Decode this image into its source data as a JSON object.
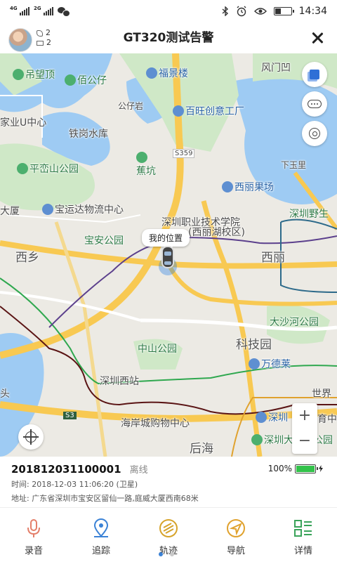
{
  "status_bar": {
    "sim1_tag": "4G",
    "sim2_tag": "2G",
    "time": "14:34",
    "icons": [
      "signal-icon",
      "wechat-icon",
      "bluetooth-icon",
      "alarm-icon",
      "eye-icon",
      "battery-icon"
    ]
  },
  "header": {
    "title": "GT320测试告警",
    "call_count": "2",
    "message_count": "2"
  },
  "map": {
    "my_location_label": "我的位置",
    "labels": {
      "l1": "吊望顶",
      "l2": "佰公仔",
      "l3": "福景楼",
      "l4": "风门凹",
      "l5": "公仔岩",
      "l6": "百旺创意工厂",
      "l7": "家业U中心",
      "l8": "铁岗水库",
      "l9": "蕉坑",
      "l10": "下玉里",
      "l11": "平峦山公园",
      "l12": "西丽果场",
      "l13": "大厦",
      "l14": "宝运达物流中心",
      "l15": "深圳职业技术学院",
      "l16": "(西丽湖校区)",
      "l17": "深圳野生",
      "l18": "宝安公园",
      "l19": "西乡",
      "l20": "西丽",
      "l21": "大沙河公园",
      "l22": "中山公园",
      "l23": "科技园",
      "l24": "万德莱",
      "l25": "深圳西站",
      "l26": "世界",
      "l27": "头",
      "l28": "深圳",
      "l29": "育中",
      "l30": "海岸城购物中心",
      "l31": "后海",
      "l32": "深圳大",
      "l33": "公园",
      "road1": "S359",
      "road2": "S3"
    },
    "zoom_in": "+",
    "zoom_out": "−",
    "colors": {
      "water": "#9ecbf3",
      "park": "#cfe8c7",
      "road_major": "#f8c952",
      "route_green": "#2fa84f",
      "route_purple": "#5b3f8c",
      "route_dark": "#5a1414",
      "route_teal": "#2d6a8a"
    }
  },
  "device": {
    "id": "201812031100001",
    "status": "离线",
    "battery": "100%",
    "battery_level": 1.0,
    "time_line": "时间: 2018-12-03 11:06:20     (卫星)",
    "address_line": "地址: 广东省深圳市宝安区留仙一路,庭威大厦西南68米"
  },
  "nav": {
    "items": [
      {
        "label": "录音",
        "icon": "microphone-icon",
        "color": "#e47f6a"
      },
      {
        "label": "追踪",
        "icon": "location-pin-icon",
        "color": "#3b82d6"
      },
      {
        "label": "轨迹",
        "icon": "track-icon",
        "color": "#d6a32a"
      },
      {
        "label": "导航",
        "icon": "navigation-icon",
        "color": "#e0a22e"
      },
      {
        "label": "详情",
        "icon": "details-icon",
        "color": "#3aa35a"
      }
    ],
    "page_count": 2,
    "active_page": 1
  }
}
